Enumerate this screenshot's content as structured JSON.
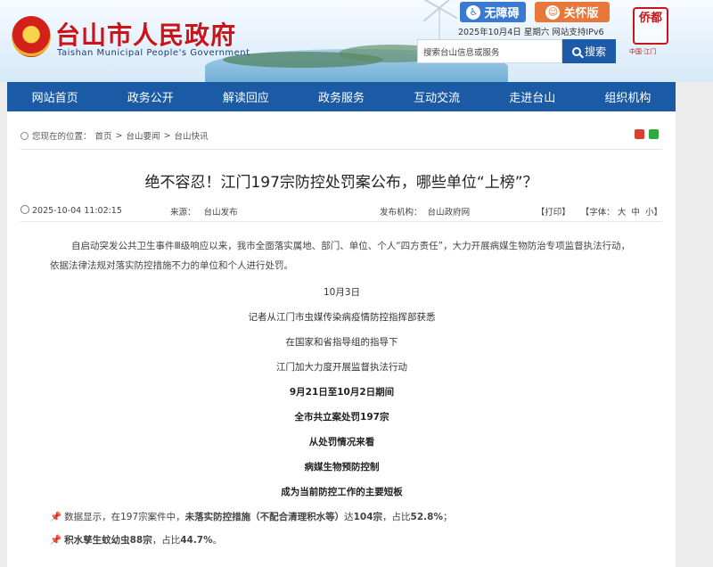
{
  "header": {
    "title": "台山市人民政府",
    "subtitle": "Taishan Municipal People's Government",
    "accessibility_label": "无障碍",
    "elderly_label": "关怀版",
    "date_text": "2025年10月4日 星期六    网站支持IPv6",
    "search_placeholder": "搜索台山信息或服务",
    "search_button": "搜索",
    "seal_text": "侨都",
    "seal_caption": "中国·江门"
  },
  "nav": [
    "网站首页",
    "政务公开",
    "解读回应",
    "政务服务",
    "互动交流",
    "走进台山",
    "组织机构"
  ],
  "breadcrumb": {
    "prefix": "您现在的位置：",
    "items": [
      "首页",
      "台山要闻",
      "台山快讯"
    ],
    "separator": ">"
  },
  "article": {
    "title": "绝不容忍！江门197宗防控处罚案公布，哪些单位“上榜”？",
    "datetime": "2025-10-04 11:02:15",
    "source_label": "来源：",
    "source_value": "台山发布",
    "org_label": "发布机构：",
    "org_value": "台山政府网",
    "print_label": "【打印】",
    "font_label": "【字体：",
    "font_large": "大",
    "font_medium": "中",
    "font_small": "小",
    "font_close": "】",
    "intro": "自启动突发公共卫生事件Ⅲ级响应以来，我市全面落实属地、部门、单位、个人“四方责任”，大力开展病媒生物防治专项监督执法行动，依据法律法规对落实防控措施不力的单位和个人进行处罚。",
    "lines": [
      {
        "text": "10月3日",
        "bold": false
      },
      {
        "text": "记者从江门市虫媒传染病疫情防控指挥部获悉",
        "bold": false
      },
      {
        "text": "在国家和省指导组的指导下",
        "bold": false
      },
      {
        "text": "江门加大力度开展监督执法行动",
        "bold": false
      },
      {
        "text": "9月21日至10月2日期间",
        "bold": true
      },
      {
        "text": "全市共立案处罚197宗",
        "bold": true
      },
      {
        "text": "从处罚情况来看",
        "bold": true
      },
      {
        "text": "病媒生物预防控制",
        "bold": true
      },
      {
        "text": "成为当前防控工作的主要短板",
        "bold": true
      }
    ],
    "bullet1": {
      "pre": "数据显示，在197宗案件中，",
      "bold1": "未落实防控措施（不配合清理积水等）",
      "mid": "达",
      "bold2": "104宗",
      "mid2": "，占比",
      "bold3": "52.8%",
      "post": "；"
    },
    "bullet2": {
      "bold1": "积水孳生蚊幼虫88宗",
      "mid": "，占比",
      "bold2": "44.7%",
      "post": "。"
    }
  }
}
